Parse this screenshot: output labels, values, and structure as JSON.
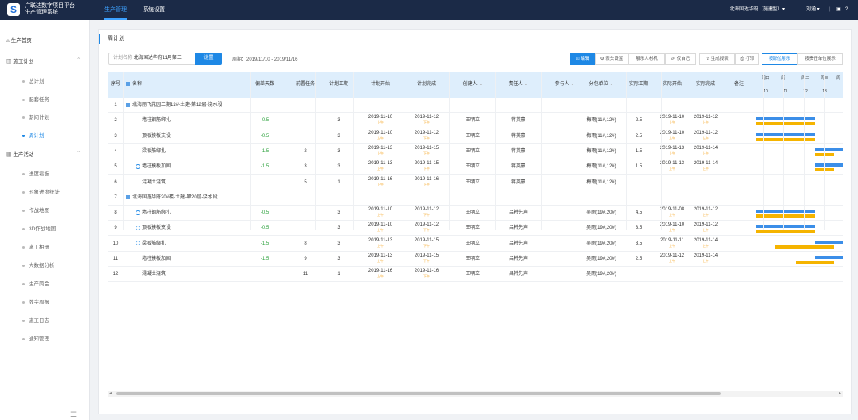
{
  "app": {
    "logo": "S",
    "title_line1": "广联达数字项目平台",
    "title_line2": "生产管理系统"
  },
  "nav": {
    "tabs": [
      "生产管理",
      "系统设置"
    ]
  },
  "topright": {
    "project": "北海国达华府（施建型）▾",
    "user": "刘涵 ▾"
  },
  "sidebar": {
    "home": "生产首页",
    "group1": "施工计划",
    "group1_items": [
      "总计划",
      "配套任务",
      "期间计划",
      "周计划"
    ],
    "group2": "生产活动",
    "group2_items": [
      "进度看板",
      "形象进度统计",
      "作战地图",
      "3D作战地图",
      "施工相册",
      "大数据分析",
      "生产简会",
      "数字周报",
      "施工日志",
      "通知管理"
    ]
  },
  "page": {
    "title": "周计划",
    "search_placeholder": "计划名称",
    "search_value": "北海国达华府11月第三",
    "set_button": "设置",
    "period": "周期：2019/11/10 - 2019/11/16",
    "toolbar": [
      "编辑",
      "表头设置",
      "展示人材机",
      "仅自己",
      "生成报表",
      "打印",
      "按部位展示",
      "按责任单位展示"
    ]
  },
  "columns": [
    "序号",
    "名称",
    "偏差天数",
    "前置任务",
    "计划工期",
    "计划开始",
    "计划完成",
    "创建人",
    "责任人",
    "参与人",
    "分包单位",
    "实际工期",
    "实际开始",
    "实际完成",
    "备注"
  ],
  "gantt": {
    "days": [
      "周日",
      "周一",
      "周二",
      "周三",
      "周"
    ],
    "dates": [
      "10",
      "11",
      "12",
      "13",
      ""
    ]
  },
  "rows": [
    {
      "no": "1",
      "name": "北海丽飞花园二期12#-土建-第12层-浇水段",
      "group": true
    },
    {
      "no": "2",
      "name": "墙柱钢筋绑扎",
      "dev": "-0.5",
      "pre": "",
      "dur": "3",
      "ps": "2019-11-10",
      "pss": "上午",
      "pe": "2019-11-12",
      "pes": "下午",
      "creator": "王明立",
      "owner": "蒋英豪",
      "part": "",
      "sub": "梅雨(11#,12#)",
      "adur": "2.5",
      "as": "2019-11-10",
      "ass": "上午",
      "ae": "2019-11-12",
      "aes": "上午"
    },
    {
      "no": "3",
      "name": "顶板模板支设",
      "dev": "-0.5",
      "pre": "",
      "dur": "3",
      "ps": "2019-11-10",
      "pss": "上午",
      "pe": "2019-11-12",
      "pes": "下午",
      "creator": "王明立",
      "owner": "蒋英豪",
      "part": "",
      "sub": "梅雨(11#,12#)",
      "adur": "2.5",
      "as": "2019-11-10",
      "ass": "上午",
      "ae": "2019-11-12",
      "aes": "上午"
    },
    {
      "no": "4",
      "name": "梁板筋绑扎",
      "dev": "-1.5",
      "pre": "2",
      "dur": "3",
      "ps": "2019-11-13",
      "pss": "上午",
      "pe": "2019-11-15",
      "pes": "下午",
      "creator": "王明立",
      "owner": "蒋英豪",
      "part": "",
      "sub": "梅雨(11#,12#)",
      "adur": "1.5",
      "as": "2019-11-13",
      "ass": "上午",
      "ae": "2019-11-14",
      "aes": "上午"
    },
    {
      "no": "5",
      "name": "墙柱模板加固",
      "dev": "-1.5",
      "pre": "3",
      "dur": "3",
      "ps": "2019-11-13",
      "pss": "上午",
      "pe": "2019-11-15",
      "pes": "下午",
      "creator": "王明立",
      "owner": "蒋英豪",
      "part": "",
      "sub": "梅雨(11#,12#)",
      "adur": "1.5",
      "as": "2019-11-13",
      "ass": "上午",
      "ae": "2019-11-14",
      "aes": "上午"
    },
    {
      "no": "6",
      "name": "混凝土浇筑",
      "dev": "",
      "pre": "5",
      "dur": "1",
      "ps": "2019-11-16",
      "pss": "上午",
      "pe": "2019-11-16",
      "pes": "下午",
      "creator": "王明立",
      "owner": "蒋英豪",
      "part": "",
      "sub": "梅雨(11#,12#)",
      "adur": "",
      "as": "",
      "ass": "",
      "ae": "",
      "aes": ""
    },
    {
      "no": "7",
      "name": "北海国鑫华府20#楼-土建-第20层-浇水段",
      "group": true
    },
    {
      "no": "8",
      "name": "墙柱钢筋绑扎",
      "dev": "-0.5",
      "pre": "",
      "dur": "3",
      "ps": "2019-11-10",
      "pss": "上午",
      "pe": "2019-11-12",
      "pes": "下午",
      "creator": "王明立",
      "owner": "吕韩先声",
      "part": "",
      "sub": "吴雨(19#,20#)",
      "adur": "4.5",
      "as": "2019-11-08",
      "ass": "上午",
      "ae": "2019-11-12",
      "aes": "上午"
    },
    {
      "no": "9",
      "name": "顶板模板支设",
      "dev": "-0.5",
      "pre": "",
      "dur": "3",
      "ps": "2019-11-10",
      "pss": "上午",
      "pe": "2019-11-12",
      "pes": "下午",
      "creator": "王明立",
      "owner": "吕韩先声",
      "part": "",
      "sub": "吴雨(19#,20#)",
      "adur": "3.5",
      "as": "2019-11-10",
      "ass": "上午",
      "ae": "2019-11-12",
      "aes": "上午"
    },
    {
      "no": "10",
      "name": "梁板筋绑扎",
      "dev": "-1.5",
      "pre": "8",
      "dur": "3",
      "ps": "2019-11-13",
      "pss": "上午",
      "pe": "2019-11-15",
      "pes": "下午",
      "creator": "王明立",
      "owner": "吕韩先声",
      "part": "",
      "sub": "吴雨(19#,20#)",
      "adur": "3.5",
      "as": "2019-11-11",
      "ass": "上午",
      "ae": "2019-11-14",
      "aes": "上午"
    },
    {
      "no": "11",
      "name": "墙柱模板加固",
      "dev": "-1.5",
      "pre": "9",
      "dur": "3",
      "ps": "2019-11-13",
      "pss": "上午",
      "pe": "2019-11-15",
      "pes": "下午",
      "creator": "王明立",
      "owner": "吕韩先声",
      "part": "",
      "sub": "吴雨(19#,20#)",
      "adur": "2.5",
      "as": "2019-11-12",
      "ass": "上午",
      "ae": "2019-11-14",
      "aes": "上午"
    },
    {
      "no": "12",
      "name": "混凝土浇筑",
      "dev": "",
      "pre": "11",
      "dur": "1",
      "ps": "2019-11-16",
      "pss": "上午",
      "pe": "2019-11-16",
      "pes": "下午",
      "creator": "王明立",
      "owner": "吕韩先声",
      "part": "",
      "sub": "吴雨(19#,20#)",
      "adur": "",
      "as": "",
      "ass": "",
      "ae": "",
      "aes": ""
    }
  ],
  "colors": {
    "plan_bar": "#3b8ee8",
    "actual_bar": "#f5b400",
    "accent": "#1e88e5"
  }
}
